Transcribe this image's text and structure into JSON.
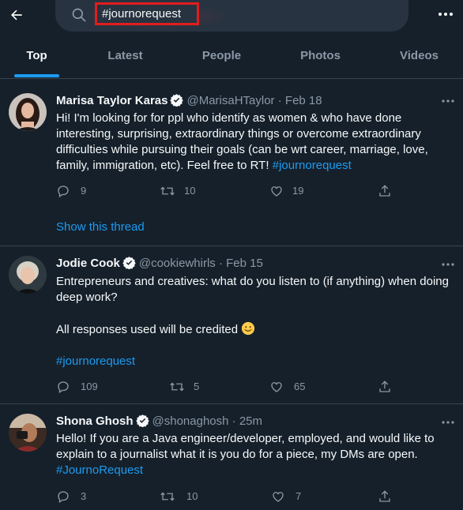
{
  "search": {
    "query": "#journorequest"
  },
  "tabs": [
    {
      "label": "Top",
      "active": true
    },
    {
      "label": "Latest"
    },
    {
      "label": "People"
    },
    {
      "label": "Photos"
    },
    {
      "label": "Videos"
    }
  ],
  "tweets": [
    {
      "name": "Marisa Taylor Karas",
      "handle": "@MarisaHTaylor",
      "sep": "·",
      "date": "Feb 18",
      "text": "Hi! I'm looking for for ppl who identify as women & who have done interesting, surprising, extraordinary things or overcome extraordinary difficulties while pursuing their goals (can be wrt career, marriage, love, family, immigration, etc). Feel free to RT!",
      "hashtag": "#journorequest",
      "replies": "9",
      "retweets": "10",
      "likes": "19",
      "show_thread": "Show this thread"
    },
    {
      "name": "Jodie Cook",
      "handle": "@cookiewhirls",
      "sep": "·",
      "date": "Feb 15",
      "text_line1": "Entrepreneurs and creatives: what do you listen to (if anything) when doing deep work?",
      "text_line2": "All responses used will be credited",
      "hashtag": "#journorequest",
      "replies": "109",
      "retweets": "5",
      "likes": "65"
    },
    {
      "name": "Shona Ghosh",
      "handle": "@shonaghosh",
      "sep": "·",
      "date": "25m",
      "text": "Hello! If you are a Java engineer/developer, employed, and would like to explain to a journalist what it is you do for a piece, my DMs are open.",
      "hashtag": "#JournoRequest",
      "replies": "3",
      "retweets": "10",
      "likes": "7"
    }
  ],
  "colors": {
    "background": "#15202b",
    "accent": "#1d9bf0",
    "muted": "#8b98a5",
    "highlight_box": "#e11d1d"
  },
  "icons": [
    "back-arrow-icon",
    "search-icon",
    "more-icon",
    "verified-icon",
    "reply-icon",
    "retweet-icon",
    "like-icon",
    "share-icon",
    "smiling-face-emoji-icon"
  ]
}
